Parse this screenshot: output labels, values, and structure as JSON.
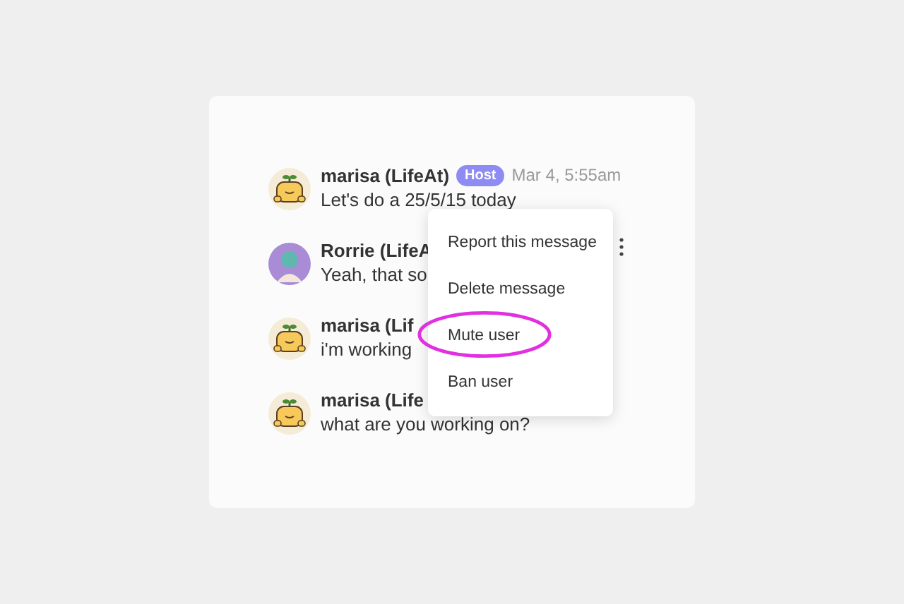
{
  "messages": [
    {
      "author": "marisa (LifeAt)",
      "kind": "sprout",
      "badge": "Host",
      "time": "Mar 4, 5:55am",
      "text": "Let's do a 25/5/15 today"
    },
    {
      "author": "Rorrie (LifeA",
      "kind": "person",
      "text": "Yeah, that so"
    },
    {
      "author": "marisa (Lif",
      "kind": "sprout",
      "text": "i'm working"
    },
    {
      "author": "marisa (Life",
      "kind": "sprout",
      "text": "what are you working on?"
    }
  ],
  "menu": {
    "items": [
      {
        "label": "Report this message",
        "highlighted": false
      },
      {
        "label": "Delete message",
        "highlighted": false
      },
      {
        "label": "Mute user",
        "highlighted": true
      },
      {
        "label": "Ban user",
        "highlighted": false
      }
    ]
  }
}
